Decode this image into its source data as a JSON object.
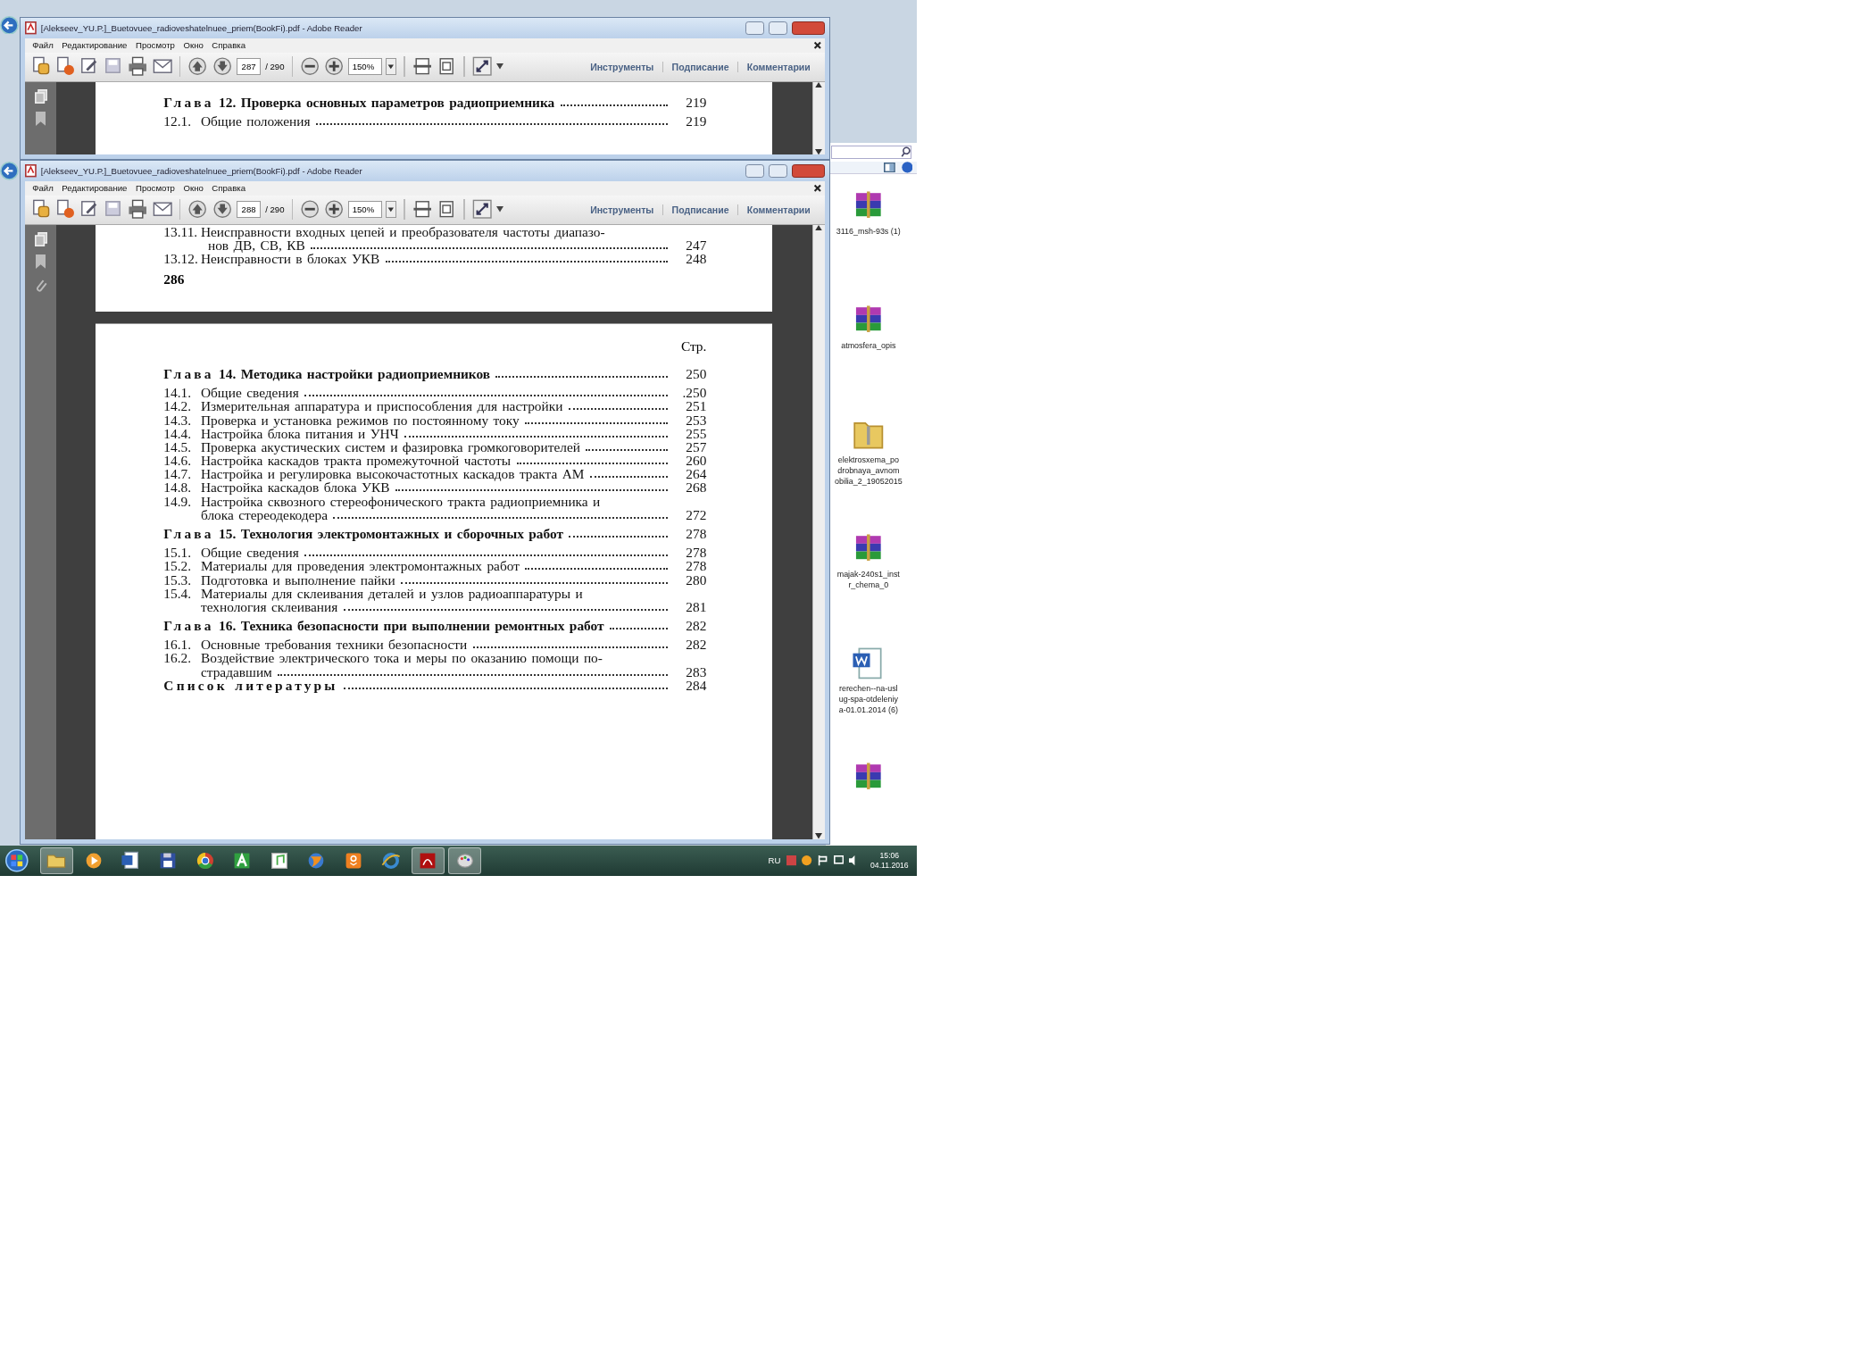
{
  "back_window": {
    "title": "[Alekseev_YU.P.]_Buetovuee_radioveshatelnuee_priem(BookFi).pdf - Adobe Reader",
    "menu": [
      "Файл",
      "Редактирование",
      "Просмотр",
      "Окно",
      "Справка"
    ],
    "toolbar": {
      "page": "287",
      "page_count": "/ 290",
      "zoom": "150%",
      "links": [
        "Инструменты",
        "Подписание",
        "Комментарии"
      ]
    },
    "document": {
      "entries": [
        {
          "kind": "chapter",
          "label": "Глава",
          "number": "12.",
          "lines": [
            "Проверка основных параметров радиоприемника"
          ],
          "page": "219"
        },
        {
          "kind": "section",
          "number": "12.1.",
          "lines": [
            "Общие положения"
          ],
          "page": "219"
        }
      ]
    }
  },
  "front_window": {
    "title": "[Alekseev_YU.P.]_Buetovuee_radioveshatelnuee_priem(BookFi).pdf - Adobe Reader",
    "menu": [
      "Файл",
      "Редактирование",
      "Просмотр",
      "Окно",
      "Справка"
    ],
    "toolbar": {
      "page": "288",
      "page_count": "/ 290",
      "zoom": "150%",
      "links": [
        "Инструменты",
        "Подписание",
        "Комментарии"
      ]
    },
    "document": {
      "previous_page": {
        "entries": [
          {
            "kind": "section",
            "number": "13.11.",
            "lines": [
              "Неисправности входных цепей и преобразователя частоты диапазо-",
              "нов ДВ, СВ, КВ"
            ],
            "page": "247"
          },
          {
            "kind": "section",
            "number": "13.12.",
            "lines": [
              "Неисправности в блоках УКВ"
            ],
            "page": "248"
          }
        ],
        "page_number": "286"
      },
      "page": {
        "column_heading": "Стр.",
        "entries": [
          {
            "kind": "chapter",
            "label": "Глава",
            "number": "14.",
            "lines": [
              "Методика настройки радиоприемников"
            ],
            "page": "250"
          },
          {
            "kind": "section",
            "number": "14.1.",
            "lines": [
              "Общие сведения"
            ],
            "page": ".250"
          },
          {
            "kind": "section",
            "number": "14.2.",
            "lines": [
              "Измерительная аппаратура и приспособления для настройки"
            ],
            "page": "251"
          },
          {
            "kind": "section",
            "number": "14.3.",
            "lines": [
              "Проверка и установка режимов по постоянному току"
            ],
            "page": "253"
          },
          {
            "kind": "section",
            "number": "14.4.",
            "lines": [
              "Настройка блока питания и УНЧ"
            ],
            "page": "255"
          },
          {
            "kind": "section",
            "number": "14.5.",
            "lines": [
              "Проверка акустических систем и фазировка громкоговорителей"
            ],
            "page": "257"
          },
          {
            "kind": "section",
            "number": "14.6.",
            "lines": [
              "Настройка каскадов тракта промежуточной частоты"
            ],
            "page": "260"
          },
          {
            "kind": "section",
            "number": "14.7.",
            "lines": [
              "Настройка и регулировка высокочастотных каскадов тракта АМ"
            ],
            "page": "264"
          },
          {
            "kind": "section",
            "number": "14.8.",
            "lines": [
              "Настройка каскадов блока УКВ"
            ],
            "page": "268"
          },
          {
            "kind": "section",
            "number": "14.9.",
            "lines": [
              "Настройка сквозного стереофонического тракта радиоприемника и",
              "блока стереодекодера"
            ],
            "page": "272"
          },
          {
            "kind": "chapter",
            "label": "Глава",
            "number": "15.",
            "lines": [
              "Технология электромонтажных и сборочных работ"
            ],
            "page": "278"
          },
          {
            "kind": "section",
            "number": "15.1.",
            "lines": [
              "Общие сведения"
            ],
            "page": "278"
          },
          {
            "kind": "section",
            "number": "15.2.",
            "lines": [
              "Материалы для проведения электромонтажных работ"
            ],
            "page": "278"
          },
          {
            "kind": "section",
            "number": "15.3.",
            "lines": [
              "Подготовка и выполнение пайки"
            ],
            "page": "280"
          },
          {
            "kind": "section",
            "number": "15.4.",
            "lines": [
              "Материалы для склеивания деталей и узлов радиоаппаратуры и",
              "технология склеивания"
            ],
            "page": "281"
          },
          {
            "kind": "chapter",
            "label": "Глава",
            "number": "16.",
            "lines": [
              "Техника безопасности при выполнении ремонтных работ"
            ],
            "page": "282"
          },
          {
            "kind": "section",
            "number": "16.1.",
            "lines": [
              "Основные требования техники безопасности"
            ],
            "page": "282"
          },
          {
            "kind": "section",
            "number": "16.2.",
            "lines": [
              "Воздействие электрического тока и меры по оказанию помощи по-",
              "страдавшим"
            ],
            "page": "283"
          },
          {
            "kind": "heading",
            "lines": [
              "Список литературы"
            ],
            "page": "284"
          }
        ]
      }
    }
  },
  "explorer": {
    "items": [
      {
        "kind": "archive",
        "lines": [
          "3116_msh-93s (1)"
        ]
      },
      {
        "kind": "archive",
        "lines": [
          "atmosfera_opis"
        ]
      },
      {
        "kind": "zip-folder",
        "lines": [
          "elektrosxema_po",
          "drobnaya_avnom",
          "obilia_2_19052015"
        ]
      },
      {
        "kind": "archive",
        "lines": [
          "majak-240s1_inst",
          "r_chema_0"
        ]
      },
      {
        "kind": "word",
        "lines": [
          "rerechen--na-usl",
          "ug-spa-otdeleniy",
          "a-01.01.2014 (6)"
        ]
      },
      {
        "kind": "archive"
      }
    ]
  },
  "taskbar": {
    "items": [
      {
        "kind": "folder",
        "running": true
      },
      {
        "kind": "media",
        "running": false
      },
      {
        "kind": "word",
        "running": false
      },
      {
        "kind": "floppy",
        "running": false
      },
      {
        "kind": "chrome",
        "running": false
      },
      {
        "kind": "letter-a",
        "running": false
      },
      {
        "kind": "music",
        "running": false
      },
      {
        "kind": "globe",
        "running": false
      },
      {
        "kind": "ok",
        "running": false
      },
      {
        "kind": "ie",
        "running": false
      },
      {
        "kind": "pdf",
        "running": true
      },
      {
        "kind": "paint",
        "running": true
      }
    ],
    "language": "RU",
    "time": "15:06",
    "date": "04.11.2016"
  }
}
